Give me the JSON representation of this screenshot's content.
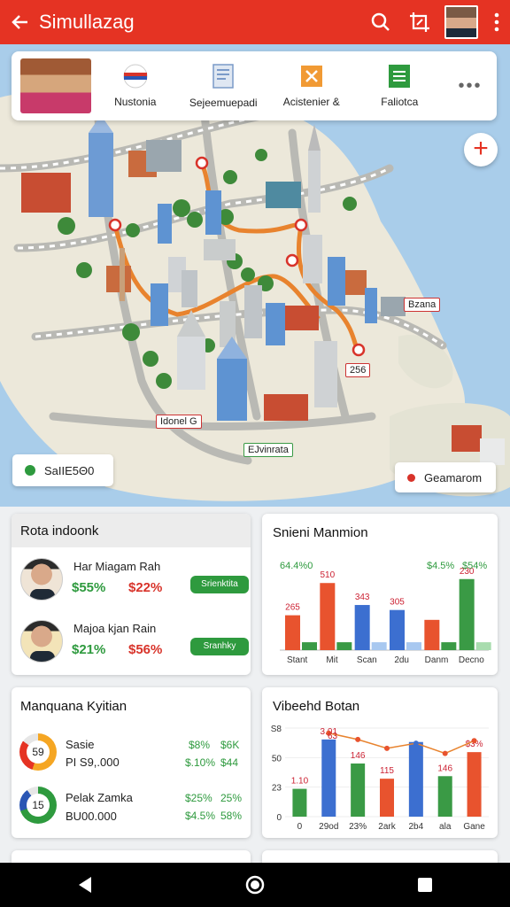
{
  "app": {
    "title": "Simullazag"
  },
  "strip": {
    "items": [
      {
        "label": "Nustonia",
        "icon": "flag-icon"
      },
      {
        "label": "Sejeemuepadi",
        "icon": "document-icon"
      },
      {
        "label": "Acistenier &",
        "icon": "tools-icon"
      },
      {
        "label": "Faliotca",
        "icon": "list-icon"
      }
    ],
    "more": "•••"
  },
  "map": {
    "labels": {
      "bzana": "Bzana",
      "idonel": "Idonel G",
      "ejvinrata": "EJvinrata",
      "n256": "256"
    },
    "chip_left": "SaIIE5Θ0",
    "chip_right": "Geamarom",
    "plus": "+"
  },
  "card1": {
    "title": "Rota indoonk",
    "people": [
      {
        "name": "Har Miagam Rah",
        "v1": "$55%",
        "v2": "$22%",
        "pill": "Srienktita"
      },
      {
        "name": "Majoa kjan Rain",
        "v1": "$21%",
        "v2": "$56%",
        "pill": "Sranhky"
      }
    ]
  },
  "card2": {
    "title": "Snieni Manmion",
    "top_labels": [
      "64.4%0",
      "$4.5%",
      "$54%"
    ]
  },
  "card3": {
    "title": "Manquana Kyitian",
    "rows": [
      {
        "ring": "59",
        "line1": "Sasie",
        "line2": "PI S9,.000",
        "a1": "$8%",
        "b1": "$6K",
        "a2": "$.10%",
        "b2": "$44"
      },
      {
        "ring": "15",
        "line1": "Pelak Zamka",
        "line2": "BU00.000",
        "a1": "$25%",
        "b1": "25%",
        "a2": "$4.5%",
        "b2": "58%"
      }
    ]
  },
  "card4": {
    "title": "Vibeehd Botan"
  },
  "chart_data": [
    {
      "type": "bar",
      "categories": [
        "Stant",
        "Mit",
        "Scan",
        "2du",
        "Danm",
        "Decno"
      ],
      "series": [
        {
          "values": [
            265,
            0,
            0,
            0,
            0,
            0
          ],
          "color": "#e8532e"
        },
        {
          "values": [
            0,
            510,
            0,
            0,
            0,
            0
          ],
          "color": "#e8532e"
        },
        {
          "values": [
            0,
            0,
            343,
            0,
            0,
            0
          ],
          "color": "#3c6fd0"
        },
        {
          "values": [
            0,
            0,
            0,
            305,
            0,
            0
          ],
          "color": "#3c6fd0"
        },
        {
          "values": [
            0,
            0,
            0,
            0,
            0,
            230
          ],
          "color": "#3a9a45"
        }
      ],
      "bar_labels": [
        "265",
        "510",
        "343",
        "305",
        "",
        "230"
      ],
      "bars": [
        {
          "cat": 0,
          "values": [
            265,
            60
          ],
          "colors": [
            "#e8532e",
            "#3a9a45"
          ]
        },
        {
          "cat": 1,
          "values": [
            510,
            60
          ],
          "colors": [
            "#e8532e",
            "#3a9a45"
          ]
        },
        {
          "cat": 2,
          "values": [
            343,
            60
          ],
          "colors": [
            "#3c6fd0",
            "#a8c8f0"
          ]
        },
        {
          "cat": 3,
          "values": [
            305,
            60
          ],
          "colors": [
            "#3c6fd0",
            "#a8c8f0"
          ]
        },
        {
          "cat": 4,
          "values": [
            230,
            60
          ],
          "colors": [
            "#e8532e",
            "#3a9a45"
          ]
        },
        {
          "cat": 5,
          "values": [
            540,
            60
          ],
          "colors": [
            "#3a9a45",
            "#a8dcae"
          ]
        }
      ],
      "ylim": [
        0,
        700
      ]
    },
    {
      "type": "bar",
      "categories": [
        "0",
        "29od",
        "23%",
        "2ark",
        "2b4",
        "ala",
        "Gane"
      ],
      "y_ticks": [
        "S8",
        "50",
        "23",
        "0"
      ],
      "bars": [
        {
          "value": 110,
          "label": "1.10",
          "color": "#3a9a45"
        },
        {
          "value": 305,
          "label": "3.01",
          "color": "#3c6fd0"
        },
        {
          "value": 210,
          "label": "146",
          "color": "#3a9a45"
        },
        {
          "value": 150,
          "label": "115",
          "color": "#e8532e"
        },
        {
          "value": 295,
          "label": "",
          "color": "#3c6fd0"
        },
        {
          "value": 160,
          "label": "146",
          "color": "#3a9a45"
        },
        {
          "value": 255,
          "label": "$3%",
          "color": "#e8532e"
        }
      ],
      "line": {
        "values": [
          0,
          330,
          305,
          270,
          290,
          250,
          300
        ],
        "color": "#e8832e"
      },
      "top_label": "63",
      "ylim": [
        0,
        350
      ]
    }
  ]
}
